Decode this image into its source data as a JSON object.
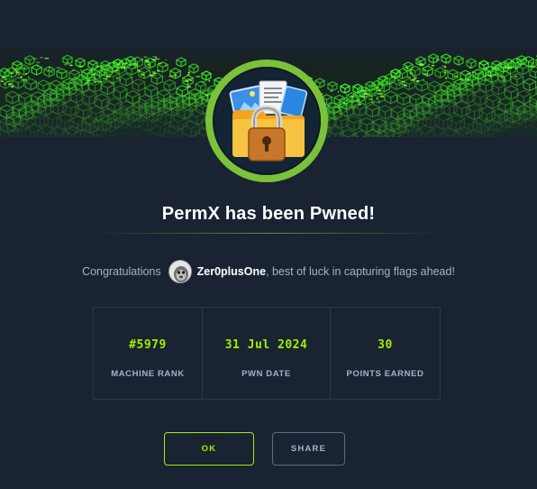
{
  "modal": {
    "title": "PermX has been Pwned!",
    "congrats_prefix": "Congratulations",
    "username": "Zer0plusOne",
    "congrats_suffix": ", best of luck in capturing flags ahead!"
  },
  "stats": [
    {
      "value": "#5979",
      "label": "MACHINE RANK"
    },
    {
      "value": "31 Jul 2024",
      "label": "PWN DATE"
    },
    {
      "value": "30",
      "label": "POINTS EARNED"
    }
  ],
  "buttons": {
    "ok": "OK",
    "share": "SHARE"
  },
  "colors": {
    "background": "#1a2332",
    "accent_green": "#9fef00",
    "badge_ring": "#7bc23a",
    "muted_text": "#a4b1cd",
    "border": "#2c3748"
  },
  "icons": {
    "badge": "locked-folder-icon",
    "avatar": "user-avatar"
  }
}
